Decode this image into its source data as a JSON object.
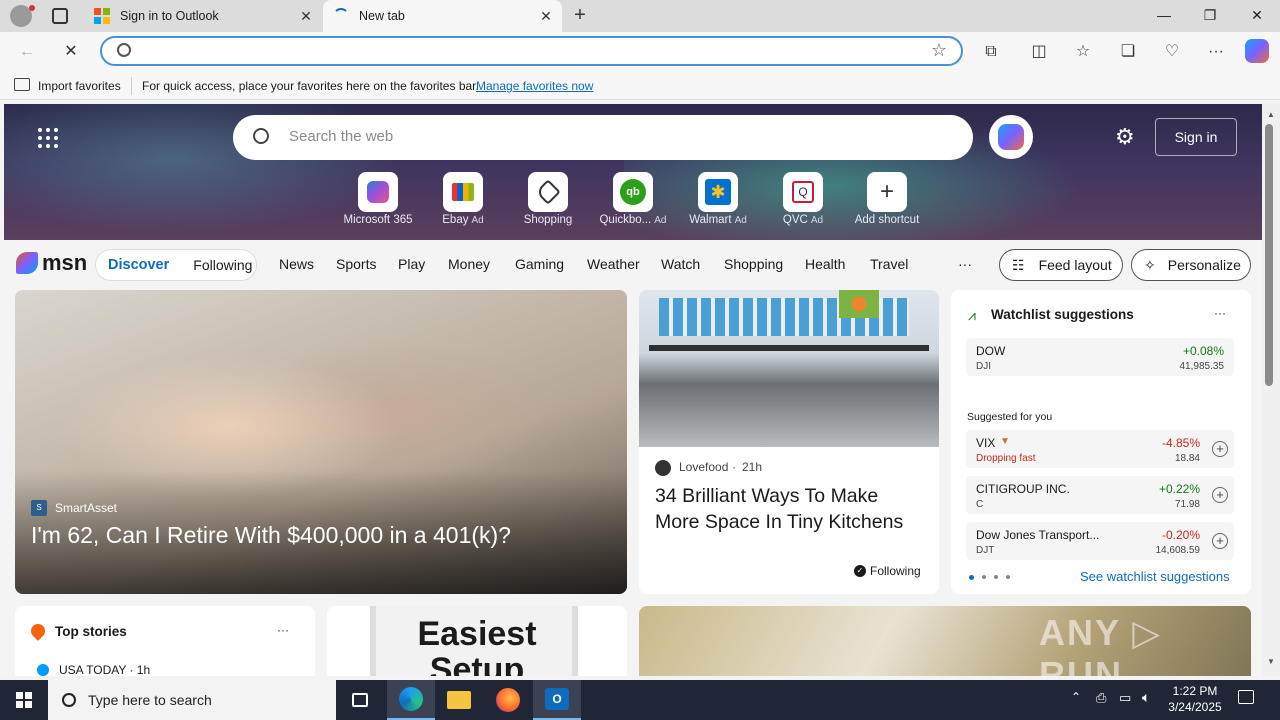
{
  "browser": {
    "tabs": [
      {
        "title": "Sign in to Outlook"
      },
      {
        "title": "New tab"
      }
    ],
    "address": {
      "value": ""
    },
    "favorites_bar": {
      "import_label": "Import favorites",
      "hint": "For quick access, place your favorites here on the favorites bar.",
      "manage_link": "Manage favorites now"
    }
  },
  "msn": {
    "search_placeholder": "Search the web",
    "sign_in": "Sign in",
    "shortcuts": [
      {
        "label": "Microsoft 365",
        "ad": "",
        "icon": "microsoft365-icon"
      },
      {
        "label": "Ebay",
        "ad": "Ad",
        "icon": "ebay-icon"
      },
      {
        "label": "Shopping",
        "ad": "",
        "icon": "shopping-tag-icon"
      },
      {
        "label": "Quickbo...",
        "ad": "Ad",
        "icon": "quickbooks-icon"
      },
      {
        "label": "Walmart",
        "ad": "Ad",
        "icon": "walmart-icon"
      },
      {
        "label": "QVC",
        "ad": "Ad",
        "icon": "qvc-icon"
      },
      {
        "label": "Add shortcut",
        "ad": "",
        "icon": "plus-icon"
      }
    ],
    "logo": "msn",
    "feed_tabs": {
      "discover": "Discover",
      "following": "Following"
    },
    "nav": [
      "News",
      "Sports",
      "Play",
      "Money",
      "Gaming",
      "Weather",
      "Watch",
      "Shopping",
      "Health",
      "Travel"
    ],
    "nav_more": "···",
    "feed_layout": "Feed layout",
    "personalize": "Personalize",
    "hero_card": {
      "source": "SmartAsset",
      "title": "I'm 62, Can I Retire With $400,000 in a 401(k)?"
    },
    "kitchen_card": {
      "source": "Lovefood",
      "age": "21h",
      "title": "34 Brilliant Ways To Make More Space In Tiny Kitchens",
      "following": "Following"
    },
    "watchlist": {
      "title": "Watchlist suggestions",
      "menu": "···",
      "dow": {
        "name": "DOW",
        "symbol": "DJI",
        "change": "+0.08%",
        "price": "41,985.35"
      },
      "suggested_label": "Suggested for you",
      "items": [
        {
          "name": "VIX",
          "symbol": "Dropping fast",
          "change": "-4.85%",
          "price": "18.84",
          "direction": "down"
        },
        {
          "name": "CITIGROUP INC.",
          "symbol": "C",
          "change": "+0.22%",
          "price": "71.98",
          "direction": "up"
        },
        {
          "name": "Dow Jones Transport...",
          "symbol": "DJT",
          "change": "-0.20%",
          "price": "14,608.59",
          "direction": "down"
        }
      ],
      "see_more": "See watchlist suggestions"
    },
    "top_stories": {
      "title": "Top stories",
      "menu": "···",
      "first_source": "USA TODAY · 1h"
    },
    "promo_text": "Easiest Setup"
  },
  "taskbar": {
    "search_placeholder": "Type here to search",
    "time": "1:22 PM",
    "date": "3/24/2025"
  },
  "colors": {
    "accent": "#0f6cbd",
    "up": "#107c10",
    "down": "#c42b1c",
    "taskbar": "#202635"
  }
}
